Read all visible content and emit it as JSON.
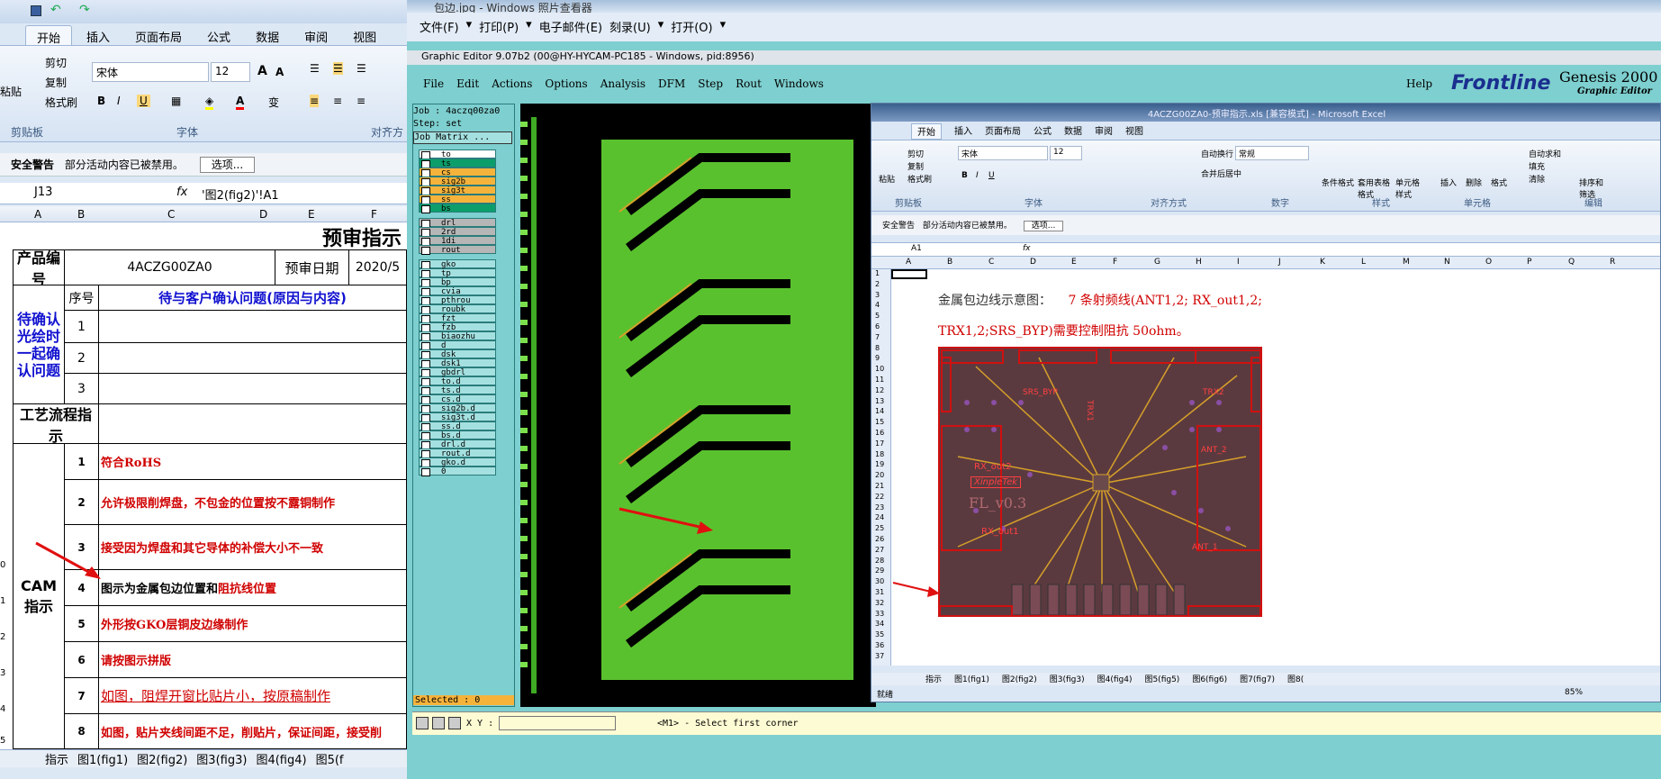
{
  "left_excel": {
    "tabs": [
      "开始",
      "插入",
      "页面布局",
      "公式",
      "数据",
      "审阅",
      "视图"
    ],
    "clipboard": {
      "paste": "粘贴",
      "cut": "剪切",
      "copy": "复制",
      "format_painter": "格式刷",
      "group": "剪贴板"
    },
    "font": {
      "name": "宋体",
      "size": "12",
      "group": "字体",
      "bold": "B",
      "italic": "I",
      "underline": "U",
      "grow": "A",
      "shrink": "A",
      "phonetic": "变"
    },
    "align_group": "对齐方",
    "security": {
      "label": "安全警告",
      "message": "部分活动内容已被禁用。",
      "options_button": "选项..."
    },
    "namebox": "J13",
    "formula": "'图2(fig2)'!A1",
    "columns": [
      "A",
      "B",
      "C",
      "D",
      "E",
      "F"
    ],
    "header_title": "预审指示",
    "product_no_label": "产品编号",
    "product_no": "4ACZG00ZA0",
    "review_date_label": "预审日期",
    "review_date": "2020/5",
    "seq_label": "序号",
    "confirm_header": "待与客户确认问题(原因与内容)",
    "pending_group": "待确认光绘时一起确认问题",
    "pending_rows": [
      "1",
      "2",
      "3"
    ],
    "process_label": "工艺流程指示",
    "cam_label": "CAM指示",
    "cam_rows": [
      {
        "no": "1",
        "text": "符合RoHS"
      },
      {
        "no": "2",
        "text": "允许极限削焊盘，不包金的位置按不露铜制作"
      },
      {
        "no": "3",
        "text": "接受因为焊盘和其它导体的补偿大小不一致"
      },
      {
        "no": "4",
        "text_a": "图示为金属包边位置和",
        "text_b": "阻抗线位置"
      },
      {
        "no": "5",
        "text": "外形按GKO层铜皮边缘制作"
      },
      {
        "no": "6",
        "text": "请按图示拼版"
      },
      {
        "no": "7",
        "text": "如图，阻焊开窗比贴片小，按原稿制作"
      },
      {
        "no": "8",
        "text": "如图，贴片夹线间距不足，削贴片，保证间距，接受削"
      }
    ],
    "row_numbers": [
      "0",
      "1",
      "2",
      "3",
      "4",
      "5"
    ],
    "sheet_tabs": [
      "指示",
      "图1(fig1)",
      "图2(fig2)",
      "图3(fig3)",
      "图4(fig4)",
      "图5(f"
    ]
  },
  "viewer": {
    "title": "包边.jpg - Windows 照片查看器",
    "menu": [
      "文件(F)",
      "打印(P)",
      "电子邮件(E)",
      "刻录(U)",
      "打开(O)"
    ]
  },
  "genesis": {
    "window_title": "Graphic Editor 9.07b2 (00@HY-HYCAM-PC185 - Windows, pid:8956)",
    "menu": [
      "File",
      "Edit",
      "Actions",
      "Options",
      "Analysis",
      "DFM",
      "Step",
      "Rout",
      "Windows"
    ],
    "help": "Help",
    "brand": "Frontline",
    "product": "Genesis 2000",
    "subtitle": "Graphic Editor",
    "job": "Job : 4aczq00za0",
    "step": "Step: set",
    "job_matrix": "Job Matrix ...",
    "layers": [
      "to",
      "ts",
      "cs",
      "sig2b",
      "sig3t",
      "ss",
      "bs",
      "drl",
      "2rd",
      "1di",
      "rout",
      "gko",
      "tp",
      "bp",
      "cvia",
      "pthrou",
      "roubk",
      "fzt",
      "fzb",
      "biaozhu",
      "d",
      "dsk",
      "dsk1",
      "gbdrl",
      "to.d",
      "ts.d",
      "cs.d",
      "sig2b.d",
      "sig3t.d",
      "ss.d",
      "bs.d",
      "drl.d",
      "rout.d",
      "gko.d",
      "0"
    ],
    "selected": "Selected : 0",
    "xy_label": "X Y :",
    "command": "<M1> - Select first corner",
    "colors": {
      "panel": "#7ecfcf",
      "pcb_green": "#3faa23",
      "trace": "#000000"
    }
  },
  "right_excel": {
    "title": "4ACZG00ZA0-预审指示.xls [兼容模式] - Microsoft Excel",
    "tabs": [
      "开始",
      "插入",
      "页面布局",
      "公式",
      "数据",
      "审阅",
      "视图"
    ],
    "clipboard": {
      "paste": "粘贴",
      "cut": "剪切",
      "copy": "复制",
      "format_painter": "格式刷",
      "group": "剪贴板"
    },
    "font": {
      "name": "宋体",
      "size": "12",
      "group": "字体"
    },
    "align": {
      "wrap": "自动换行",
      "merge": "合并后居中",
      "group": "对齐方式"
    },
    "number": {
      "format": "常规",
      "group": "数字"
    },
    "styles": {
      "conditional": "条件格式",
      "table": "套用表格格式",
      "cell": "单元格样式",
      "group": "样式"
    },
    "cells": {
      "insert": "插入",
      "delete": "删除",
      "format": "格式",
      "group": "单元格"
    },
    "editing": {
      "autosum": "自动求和",
      "fill": "填充",
      "clear": "清除",
      "sort": "排序和筛选",
      "group": "编辑"
    },
    "security": {
      "label": "安全警告",
      "message": "部分活动内容已被禁用。",
      "options_button": "选项..."
    },
    "namebox": "A1",
    "columns": [
      "A",
      "B",
      "C",
      "D",
      "E",
      "F",
      "G",
      "H",
      "I",
      "J",
      "K",
      "L",
      "M",
      "N",
      "O",
      "P",
      "Q",
      "R"
    ],
    "rows": [
      "1",
      "2",
      "3",
      "4",
      "5",
      "6",
      "7",
      "8",
      "9",
      "10",
      "11",
      "12",
      "13",
      "14",
      "15",
      "16",
      "17",
      "18",
      "19",
      "20",
      "21",
      "22",
      "23",
      "24",
      "25",
      "26",
      "27",
      "28",
      "29",
      "30",
      "31",
      "32",
      "33",
      "34",
      "35",
      "36",
      "37"
    ],
    "note_black": "金属包边线示意图：",
    "note_red1": "7 条射频线(ANT1,2; RX_out1,2;",
    "note_red2": "TRX1,2;SRS_BYP)需要控制阻抗 50ohm。",
    "pcb_labels": [
      "SRS_BYP",
      "TRX1",
      "TRX2",
      "ANT_2",
      "RX_out2",
      "XinpleTek",
      "FL_v0.3",
      "RX_out1",
      "ANT_1"
    ],
    "sheet_tabs": [
      "指示",
      "图1(fig1)",
      "图2(fig2)",
      "图3(fig3)",
      "图4(fig4)",
      "图5(fig5)",
      "图6(fig6)",
      "图7(fig7)",
      "图8("
    ],
    "status": "就绪",
    "zoom": "85%"
  }
}
